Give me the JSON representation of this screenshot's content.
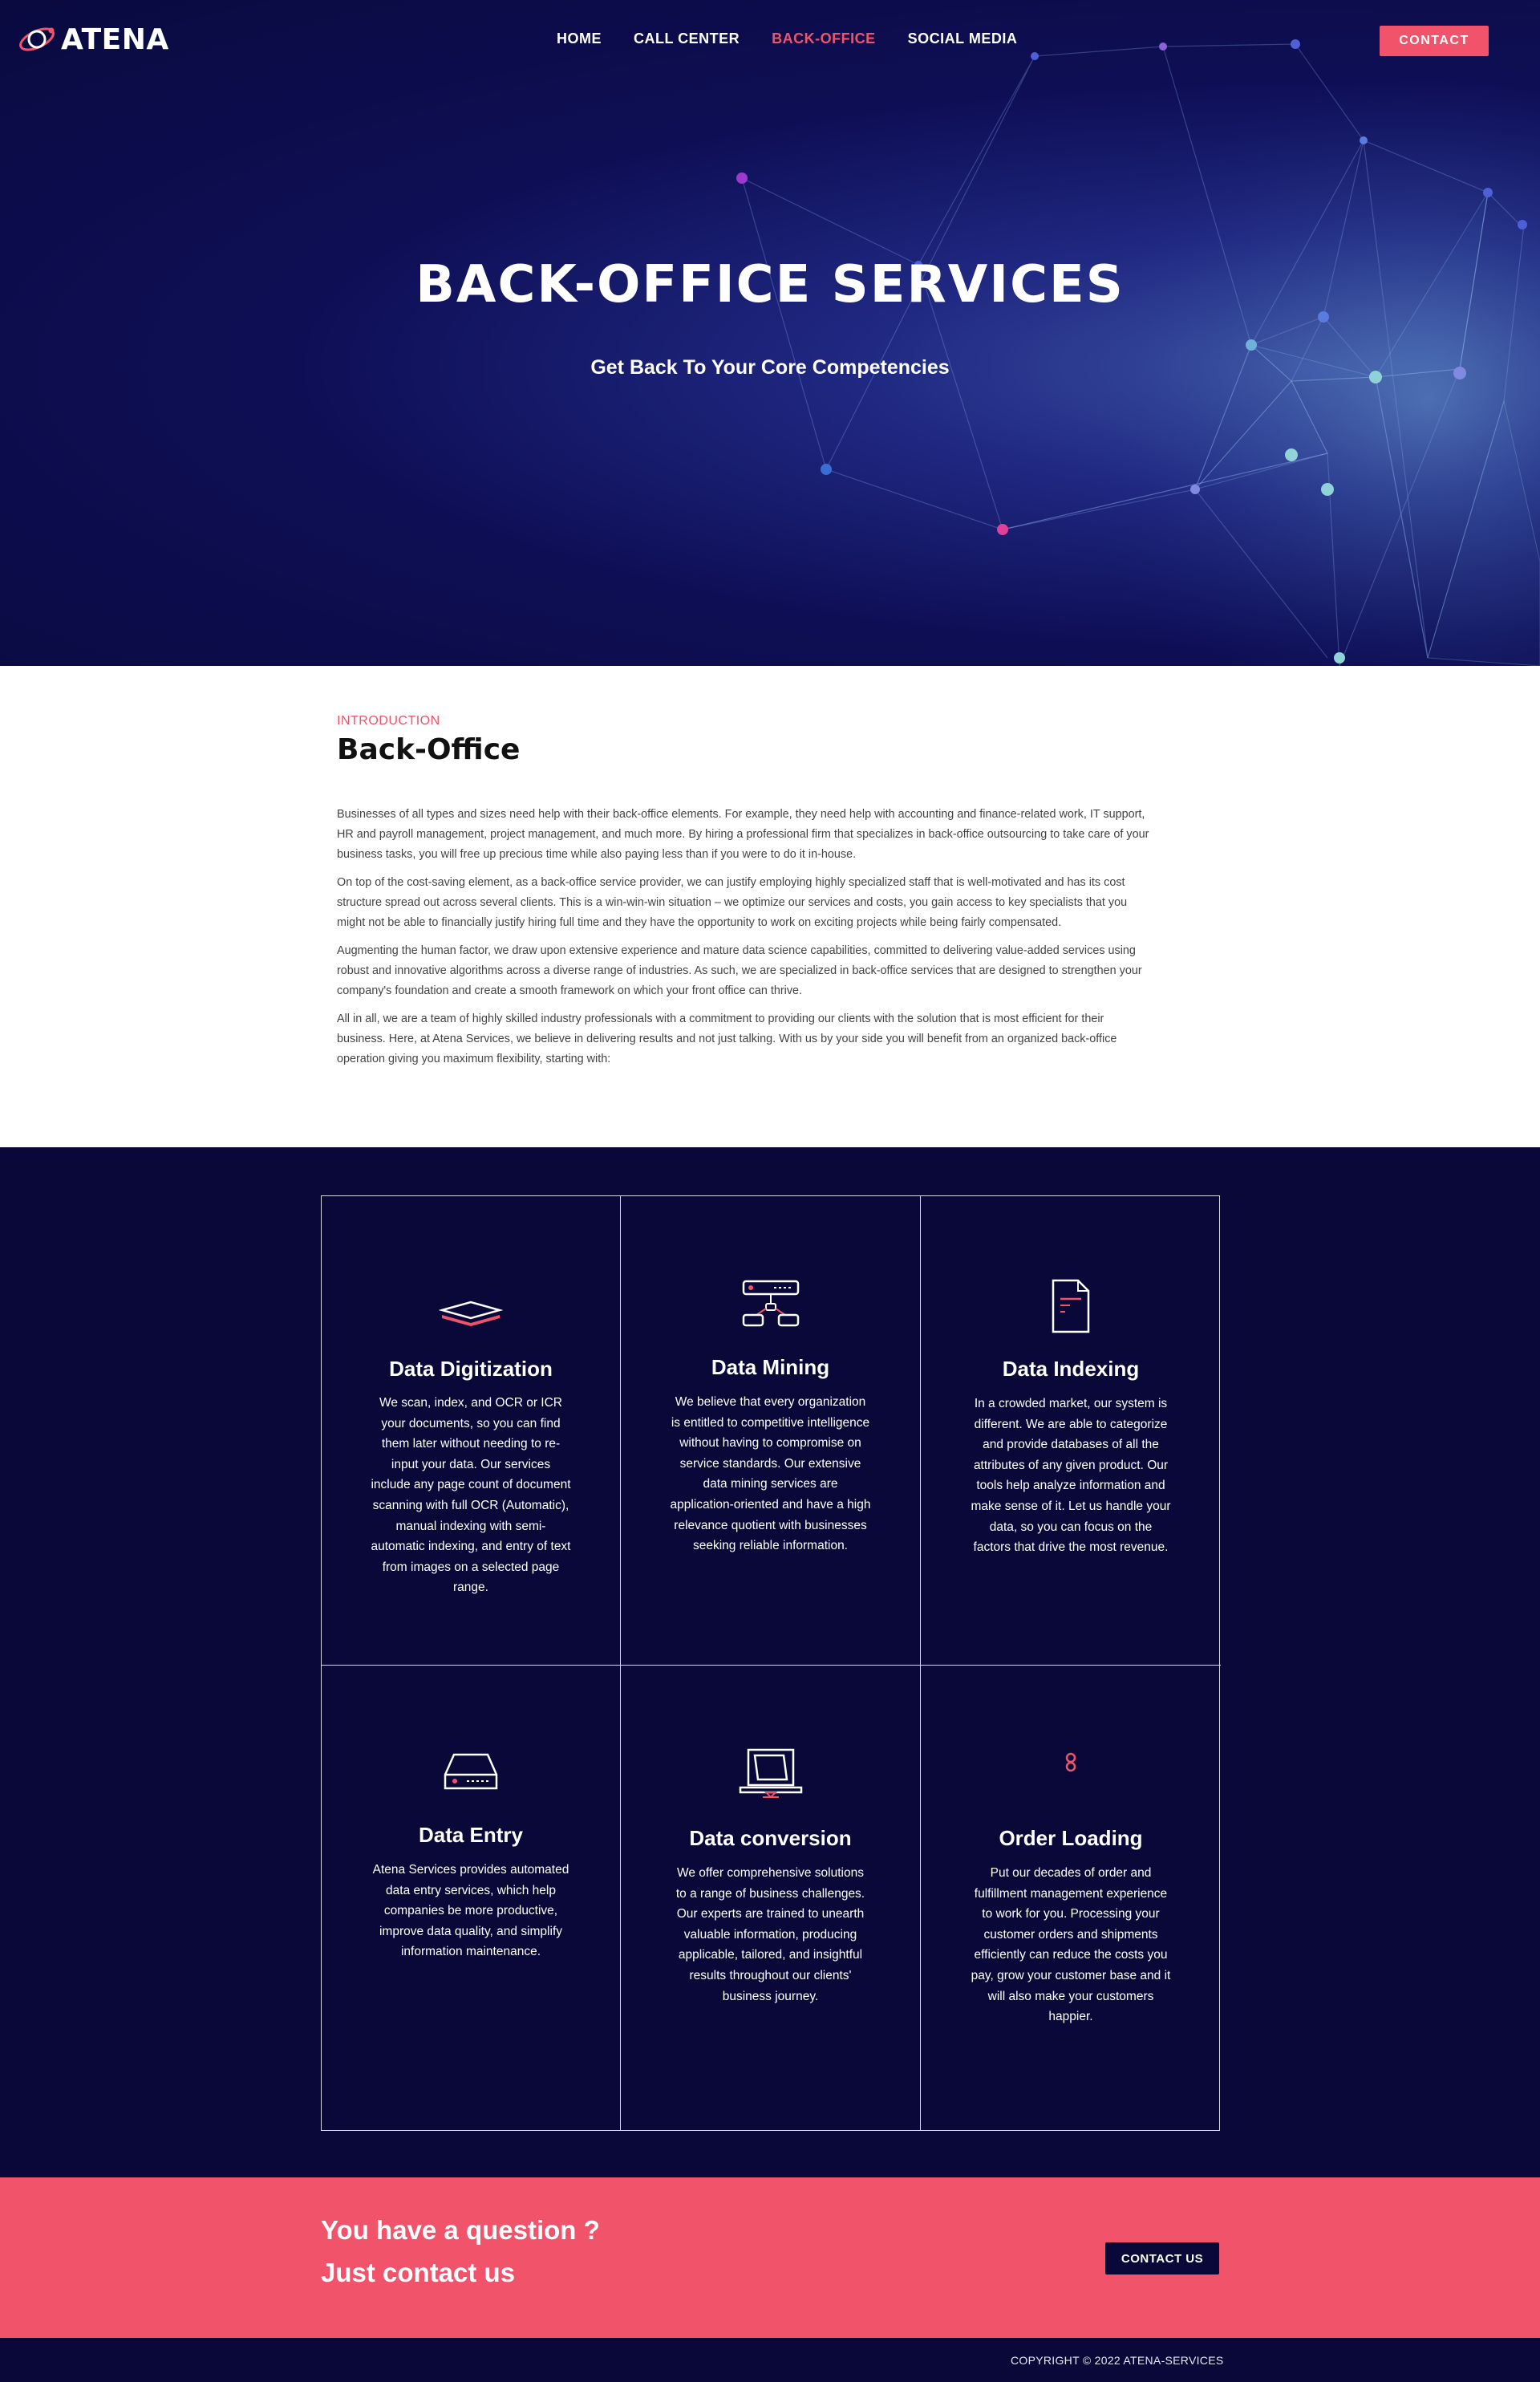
{
  "brand": {
    "name": "ATENA",
    "accent": "#f0536a",
    "navy": "#090838"
  },
  "nav": {
    "items": [
      {
        "label": "HOME",
        "active": false
      },
      {
        "label": "CALL CENTER",
        "active": false
      },
      {
        "label": "BACK-OFFICE",
        "active": true
      },
      {
        "label": "SOCIAL MEDIA",
        "active": false
      }
    ],
    "contact_label": "CONTACT"
  },
  "hero": {
    "title": "BACK-OFFICE SERVICES",
    "subtitle": "Get Back To Your Core Competencies"
  },
  "intro": {
    "kicker": "INTRODUCTION",
    "title": "Back-Office",
    "paragraphs": [
      "Businesses of all types and sizes need help with their back-office elements. For example, they need help with accounting and finance-related work, IT support, HR and payroll management, project management, and much more. By hiring a professional firm that specializes in back-office outsourcing to take care of your business tasks, you will free up precious time while also paying less than if you were to do it in-house.",
      "On top of the cost-saving element, as a back-office service provider, we can justify employing highly specialized staff that is well-motivated and has its cost structure spread out across several clients.  This is a win-win-win situation – we optimize our services and costs, you gain access to key specialists that you might not be able to financially justify hiring full time and they have the opportunity to work on exciting projects while being fairly compensated.",
      "Augmenting the human factor, we draw upon extensive experience and mature data science capabilities, committed to delivering value-added services using robust and innovative algorithms across a diverse range of industries. As such, we are specialized in back-office services that are designed to strengthen your company's foundation and create a smooth framework on which your front office can thrive.",
      "All in all, we are a team of highly skilled industry professionals with a commitment to providing our clients with the solution that is most efficient for their business. Here, at Atena Services, we believe in delivering results and not just talking. With us by your side you will benefit from an organized back-office operation giving you maximum flexibility, starting with:"
    ]
  },
  "services": [
    {
      "icon": "layers-icon",
      "title": "Data Digitization",
      "text": "We scan, index, and OCR or ICR your documents, so you can find them later without needing to re-input your data. Our services include any page count of document scanning with full OCR (Automatic), manual indexing with semi-automatic indexing, and entry of text from images on a selected page range."
    },
    {
      "icon": "network-server-icon",
      "title": "Data Mining",
      "text": "We believe that every organization is entitled to competitive intelligence without having to compromise on service standards. Our extensive data mining services are application-oriented and have a high relevance quotient with businesses seeking reliable information."
    },
    {
      "icon": "document-icon",
      "title": "Data Indexing",
      "text": "In a crowded market, our system is different. We are able to categorize and provide databases of all the attributes of any given product. Our tools help analyze information and make sense of it. Let us handle your data, so you can focus on the factors that drive the most revenue."
    },
    {
      "icon": "hard-drive-icon",
      "title": "Data Entry",
      "text": "Atena Services provides automated data entry services, which help companies be more productive, improve data quality, and simplify information maintenance."
    },
    {
      "icon": "laptop-icon",
      "title": "Data conversion",
      "text": "We offer comprehensive solutions to a range of business challenges. Our experts are trained to unearth valuable information, producing applicable, tailored, and insightful results throughout our clients' business journey."
    },
    {
      "icon": "link-icon",
      "title": "Order Loading",
      "text": "Put our decades of order and fulfillment management experience to work for you. Processing your customer orders and shipments efficiently can reduce the costs you pay, grow your customer base and it will also make your customers happier."
    }
  ],
  "cta": {
    "line1": "You have a question ?",
    "line2": "Just contact us",
    "button_label": "CONTACT US"
  },
  "footer": {
    "copyright": "COPYRIGHT © 2022 ATENA-SERVICES"
  }
}
